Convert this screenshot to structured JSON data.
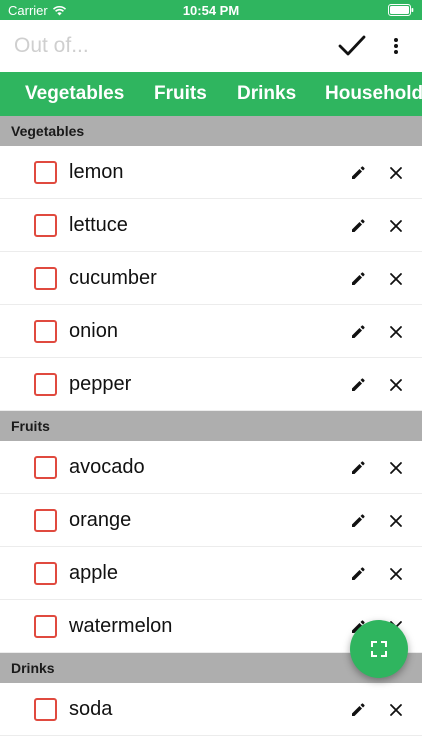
{
  "status_bar": {
    "carrier": "Carrier",
    "time": "10:54 PM"
  },
  "header": {
    "search_placeholder": "Out of...",
    "search_value": ""
  },
  "tabs": [
    {
      "label": "Vegetables"
    },
    {
      "label": "Fruits"
    },
    {
      "label": "Drinks"
    },
    {
      "label": "Household"
    }
  ],
  "sections": [
    {
      "title": "Vegetables",
      "items": [
        {
          "name": "lemon",
          "checked": false
        },
        {
          "name": "lettuce",
          "checked": false
        },
        {
          "name": "cucumber",
          "checked": false
        },
        {
          "name": "onion",
          "checked": false
        },
        {
          "name": "pepper",
          "checked": false
        }
      ]
    },
    {
      "title": "Fruits",
      "items": [
        {
          "name": "avocado",
          "checked": false
        },
        {
          "name": "orange",
          "checked": false
        },
        {
          "name": "apple",
          "checked": false
        },
        {
          "name": "watermelon",
          "checked": false
        }
      ]
    },
    {
      "title": "Drinks",
      "items": [
        {
          "name": "soda",
          "checked": false
        }
      ]
    }
  ],
  "icons": {
    "status_wifi": "wifi-icon",
    "status_battery": "battery-icon",
    "confirm": "checkmark-icon",
    "more": "more-vertical-icon",
    "edit": "pencil-icon",
    "delete": "close-icon",
    "fab": "fullscreen-icon"
  },
  "colors": {
    "brand_green": "#2fb55f",
    "checkbox_red": "#e04a3f",
    "section_gray": "#aeaeae"
  }
}
